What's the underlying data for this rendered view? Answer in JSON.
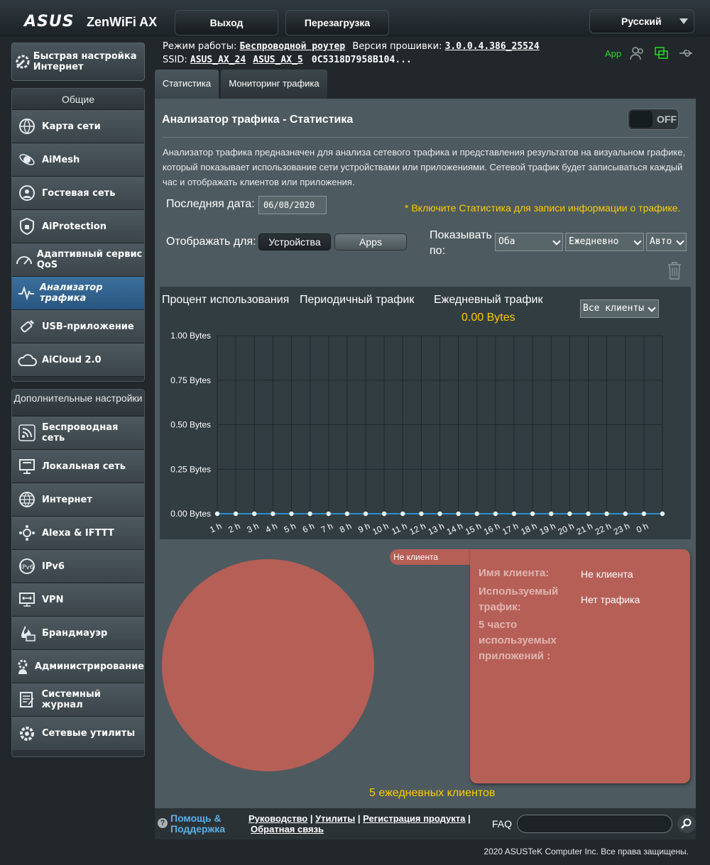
{
  "header": {
    "brand": "ASUS",
    "model": "ZenWiFi AX",
    "logout": "Выход",
    "reboot": "Перезагрузка",
    "language": "Русский"
  },
  "info": {
    "mode_label": "Режим работы:",
    "mode_value": "Беспроводной роутер",
    "fw_label": "Версия прошивки:",
    "fw_value": "3.0.0.4.386_25524",
    "ssid_label": "SSID:",
    "ssid1": "ASUS_AX_24",
    "ssid2": "ASUS_AX_5",
    "ssid3": "0C5318D7958B104...",
    "app_label": "App"
  },
  "sidebar": {
    "quick_setup": "Быстрая настройка Интернет",
    "general_header": "Общие",
    "general": [
      {
        "label": "Карта сети",
        "icon": "network-map-icon"
      },
      {
        "label": "AiMesh",
        "icon": "aimesh-icon"
      },
      {
        "label": "Гостевая сеть",
        "icon": "guest-network-icon"
      },
      {
        "label": "AiProtection",
        "icon": "shield-icon"
      },
      {
        "label": "Адаптивный сервис QoS",
        "icon": "qos-gauge-icon"
      },
      {
        "label": "Анализатор трафика",
        "icon": "traffic-analyzer-icon"
      },
      {
        "label": "USB-приложение",
        "icon": "usb-icon"
      },
      {
        "label": "AiCloud 2.0",
        "icon": "cloud-icon"
      }
    ],
    "advanced_header": "Дополнительные настройки",
    "advanced": [
      {
        "label": "Беспроводная сеть",
        "icon": "wireless-icon"
      },
      {
        "label": "Локальная сеть",
        "icon": "lan-icon"
      },
      {
        "label": "Интернет",
        "icon": "globe-icon"
      },
      {
        "label": "Alexa & IFTTT",
        "icon": "alexa-icon"
      },
      {
        "label": "IPv6",
        "icon": "ipv6-icon"
      },
      {
        "label": "VPN",
        "icon": "vpn-icon"
      },
      {
        "label": "Брандмауэр",
        "icon": "firewall-icon"
      },
      {
        "label": "Администрирование",
        "icon": "admin-gear-icon"
      },
      {
        "label": "Системный журнал",
        "icon": "log-icon"
      },
      {
        "label": "Сетевые утилиты",
        "icon": "tools-icon"
      }
    ]
  },
  "tabs": {
    "stats": "Статистика",
    "monitor": "Мониторинг трафика"
  },
  "panel": {
    "title": "Анализатор трафика - Статистика",
    "toggle": "OFF",
    "description": "Анализатор трафика предназначен для анализа сетевого трафика и представления результатов на визуальном графике, который показывает использование сети устройствами или приложениями. Сетевой трафик будет записываться каждый час и отображать клиентов или приложения.",
    "last_date_label": "Последняя дата:",
    "last_date_value": "06/08/2020",
    "notice": "* Включите Статистика для записи информации о трафике.",
    "show_for_label": "Отображать для:",
    "devices": "Устройства",
    "apps": "Apps",
    "show_by_label": "Показывать по:",
    "sel_direction": "Оба",
    "sel_period": "Ежедневно",
    "sel_scale": "Авто"
  },
  "chart": {
    "tab_pct": "Процент использования",
    "tab_periodic": "Периодичный трафик",
    "tab_daily": "Ежедневный трафик",
    "total": "0.00 Bytes",
    "clients_select": "Все клиенты"
  },
  "chart_data": {
    "type": "line",
    "title": "",
    "xlabel": "",
    "ylabel": "",
    "categories": [
      "1 h",
      "2 h",
      "3 h",
      "4 h",
      "5 h",
      "6 h",
      "7 h",
      "8 h",
      "9 h",
      "10 h",
      "11 h",
      "12 h",
      "13 h",
      "14 h",
      "15 h",
      "16 h",
      "17 h",
      "18 h",
      "19 h",
      "20 h",
      "21 h",
      "22 h",
      "23 h",
      "0 h"
    ],
    "y_ticks": [
      "1.00 Bytes",
      "0.75 Bytes",
      "0.50 Bytes",
      "0.25 Bytes",
      "0.00 Bytes"
    ],
    "ylim": [
      0,
      1
    ],
    "grid": true,
    "series": [
      {
        "values": [
          0,
          0,
          0,
          0,
          0,
          0,
          0,
          0,
          0,
          0,
          0,
          0,
          0,
          0,
          0,
          0,
          0,
          0,
          0,
          0,
          0,
          0,
          0,
          0,
          0
        ]
      }
    ],
    "colors": {
      "line": "#2a8fd0",
      "point": "#e8f4ff"
    }
  },
  "pie": {
    "tag": "Не клиента",
    "name_label": "Имя клиента:",
    "name_value": "Не клиента",
    "traffic_label": "Используемый трафик:",
    "traffic_value": "Нет трафика",
    "apps_label": "5 часто используемых приложений :",
    "daily_clients": "5 ежедневных клиентов",
    "color": "#b55f57"
  },
  "footer": {
    "help": "Помощь & Поддержка",
    "manual": "Руководство",
    "utils": "Утилиты",
    "register": "Регистрация продукта",
    "feedback": "Обратная связь",
    "faq": "FAQ",
    "copyright": "2020 ASUSTeK Computer Inc. Все права защищены."
  }
}
